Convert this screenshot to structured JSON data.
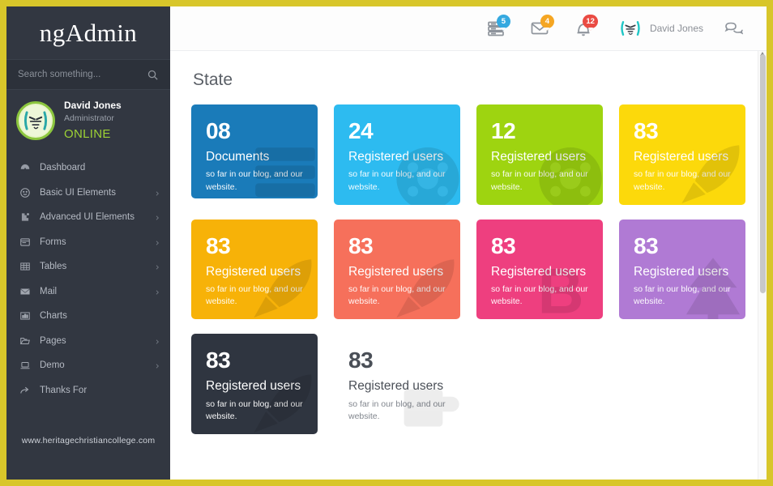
{
  "theme": {
    "frame_border": "#d8c62a",
    "sidebar_bg": "#323741",
    "accent_online": "#9dd235"
  },
  "sidebar": {
    "brand": "ngAdmin",
    "search": {
      "placeholder": "Search something...",
      "value": "",
      "icon": "search-icon"
    },
    "profile": {
      "name": "David Jones",
      "role": "Administrator",
      "status": "ONLINE",
      "avatar_icon": "avatar-face-icon"
    },
    "items": [
      {
        "label": "Dashboard",
        "icon": "dashboard-icon",
        "has_caret": false
      },
      {
        "label": "Basic UI Elements",
        "icon": "smiley-icon",
        "has_caret": true
      },
      {
        "label": "Advanced UI Elements",
        "icon": "puzzle-icon",
        "has_caret": true
      },
      {
        "label": "Forms",
        "icon": "form-icon",
        "has_caret": true
      },
      {
        "label": "Tables",
        "icon": "table-icon",
        "has_caret": true
      },
      {
        "label": "Mail",
        "icon": "mail-icon",
        "has_caret": true
      },
      {
        "label": "Charts",
        "icon": "chart-icon",
        "has_caret": false
      },
      {
        "label": "Pages",
        "icon": "folder-icon",
        "has_caret": true
      },
      {
        "label": "Demo",
        "icon": "laptop-icon",
        "has_caret": true
      },
      {
        "label": "Thanks For",
        "icon": "share-arrow-icon",
        "has_caret": false
      }
    ],
    "footer_url": "www.heritagechristiancollege.com"
  },
  "topbar": {
    "icons": [
      {
        "name": "server-icon",
        "badge": "5",
        "badge_color": "#35a9e0"
      },
      {
        "name": "envelope-icon",
        "badge": "4",
        "badge_color": "#f5a623"
      },
      {
        "name": "bell-icon",
        "badge": "12",
        "badge_color": "#ea4b43"
      }
    ],
    "user": {
      "name": "David Jones",
      "avatar_icon": "avatar-face-icon"
    },
    "chat_icon": "chat-bubble-icon"
  },
  "main": {
    "page_title": "State",
    "tiles": [
      {
        "num": "08",
        "label": "Documents",
        "desc": "so far in our blog, and our website.",
        "bg": "#1a7bb9",
        "ghost": "server-icon",
        "light": false
      },
      {
        "num": "24",
        "label": "Registered users",
        "desc": "so far in our blog, and our website.",
        "bg": "#2dbbf0",
        "ghost": "camera-icon",
        "light": false
      },
      {
        "num": "12",
        "label": "Registered users",
        "desc": "so far in our blog, and our website.",
        "bg": "#9ed410",
        "ghost": "camera-icon",
        "light": false
      },
      {
        "num": "83",
        "label": "Registered users",
        "desc": "so far in our blog, and our website.",
        "bg": "#fcd90b",
        "ghost": "rocket-icon",
        "light": false
      },
      {
        "num": "83",
        "label": "Registered users",
        "desc": "so far in our blog, and our website.",
        "bg": "#f7b208",
        "ghost": "rocket-icon",
        "light": false
      },
      {
        "num": "83",
        "label": "Registered users",
        "desc": "so far in our blog, and our website.",
        "bg": "#f6705b",
        "ghost": "rocket-icon",
        "light": false
      },
      {
        "num": "83",
        "label": "Registered users",
        "desc": "so far in our blog, and our website.",
        "bg": "#ee3f7f",
        "ghost": "bold-b-icon",
        "light": false
      },
      {
        "num": "83",
        "label": "Registered users",
        "desc": "so far in our blog, and our website.",
        "bg": "#b07ad4",
        "ghost": "tree-icon",
        "light": false
      },
      {
        "num": "83",
        "label": "Registered users",
        "desc": "so far in our blog, and our website.",
        "bg": "#2f3540",
        "ghost": "rocket-icon",
        "light": false
      },
      {
        "num": "83",
        "label": "Registered users",
        "desc": "so far in our blog, and our website.",
        "bg": "#ffffff",
        "ghost": "cup-icon",
        "light": true
      }
    ]
  }
}
